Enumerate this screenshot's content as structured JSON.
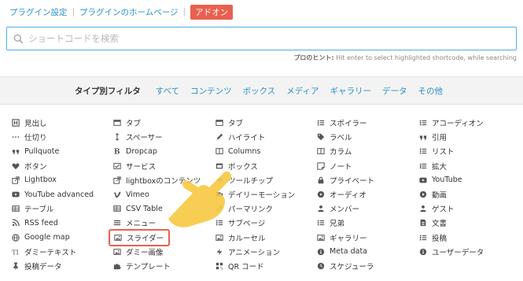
{
  "toplinks": {
    "settings": "プラグイン設定",
    "homepage": "プラグインのホームページ",
    "addon": "アドオン"
  },
  "search": {
    "placeholder": "ショートコードを検索"
  },
  "hint": {
    "label": "プロのヒント:",
    "text": "Hit enter to select highlighted shortcode, while searching"
  },
  "filter": {
    "label": "タイプ別フィルタ",
    "items": [
      "すべて",
      "コンテンツ",
      "ボックス",
      "メディア",
      "ギャラリー",
      "データ",
      "その他"
    ]
  },
  "columns": [
    [
      {
        "icon": "heading-icon",
        "label": "見出し"
      },
      {
        "icon": "divider-icon",
        "label": "仕切り"
      },
      {
        "icon": "quote-icon",
        "label": "Pullquote"
      },
      {
        "icon": "heart-icon",
        "label": "ボタン"
      },
      {
        "icon": "external-link-icon",
        "label": "Lightbox"
      },
      {
        "icon": "youtube-icon",
        "label": "YouTube advanced"
      },
      {
        "icon": "table-icon",
        "label": "テーブル"
      },
      {
        "icon": "rss-icon",
        "label": "RSS feed"
      },
      {
        "icon": "globe-icon",
        "label": "Google map"
      },
      {
        "icon": "text-height-icon",
        "label": "ダミーテキスト"
      },
      {
        "icon": "thumb-tack-icon",
        "label": "投稿データ"
      }
    ],
    [
      {
        "icon": "tab-icon",
        "label": "タブ"
      },
      {
        "icon": "spacer-icon",
        "label": "スペーサー"
      },
      {
        "icon": "bold-icon",
        "label": "Dropcap"
      },
      {
        "icon": "service-icon",
        "label": "サービス"
      },
      {
        "icon": "external-link-icon",
        "label": "lightboxのコンテンツ"
      },
      {
        "icon": "vimeo-icon",
        "label": "Vimeo"
      },
      {
        "icon": "table-icon",
        "label": "CSV Table"
      },
      {
        "icon": "menu-icon",
        "label": "メニュー"
      },
      {
        "icon": "image-icon",
        "label": "スライダー"
      },
      {
        "icon": "image-icon",
        "label": "ダミー画像"
      },
      {
        "icon": "puzzle-icon",
        "label": "テンプレート"
      }
    ],
    [
      {
        "icon": "tab-icon",
        "label": "タブ"
      },
      {
        "icon": "pencil-icon",
        "label": "ハイライト"
      },
      {
        "icon": "columns-icon",
        "label": "Columns"
      },
      {
        "icon": "box-icon",
        "label": "ボックス"
      },
      {
        "icon": "share-icon",
        "label": "ツールチップ"
      },
      {
        "icon": "video-icon",
        "label": "デイリーモーション"
      },
      {
        "icon": "link-icon",
        "label": "パーマリンク"
      },
      {
        "icon": "list-icon",
        "label": "サブページ"
      },
      {
        "icon": "image-icon",
        "label": "カルーセル"
      },
      {
        "icon": "bolt-icon",
        "label": "アニメーション"
      },
      {
        "icon": "qrcode-icon",
        "label": "QR コード"
      }
    ],
    [
      {
        "icon": "list-icon",
        "label": "スポイラー"
      },
      {
        "icon": "tag-icon",
        "label": "ラベル"
      },
      {
        "icon": "columns-icon",
        "label": "カラム"
      },
      {
        "icon": "note-icon",
        "label": "ノート"
      },
      {
        "icon": "lock-icon",
        "label": "プライベート"
      },
      {
        "icon": "audio-icon",
        "label": "オーディオ"
      },
      {
        "icon": "user-icon",
        "label": "メンバー"
      },
      {
        "icon": "list-icon",
        "label": "兄弟"
      },
      {
        "icon": "image-icon",
        "label": "ギャラリー"
      },
      {
        "icon": "info-icon",
        "label": "Meta data"
      },
      {
        "icon": "clock-icon",
        "label": "スケジューラ"
      }
    ],
    [
      {
        "icon": "list-icon",
        "label": "アコーディオン"
      },
      {
        "icon": "quote-icon",
        "label": "引用"
      },
      {
        "icon": "list-icon",
        "label": "リスト"
      },
      {
        "icon": "expand-icon",
        "label": "拡大"
      },
      {
        "icon": "youtube-icon",
        "label": "YouTube"
      },
      {
        "icon": "play-icon",
        "label": "動画"
      },
      {
        "icon": "user-icon",
        "label": "ゲスト"
      },
      {
        "icon": "file-icon",
        "label": "文書"
      },
      {
        "icon": "list-icon",
        "label": "投稿"
      },
      {
        "icon": "info-icon",
        "label": "ユーザーデータ"
      }
    ]
  ],
  "highlighted": "スライダー"
}
